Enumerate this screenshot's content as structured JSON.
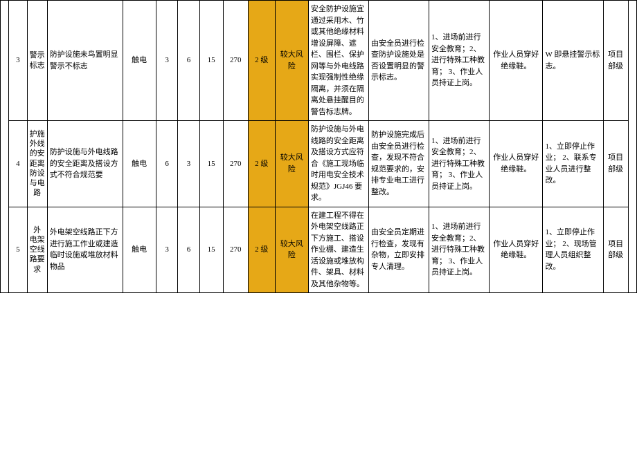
{
  "rows": [
    {
      "idx": "3",
      "cat": "警示标志",
      "desc": "防护设施未鸟置明显警示不标志",
      "hazard": "触电",
      "n1": "3",
      "n2": "6",
      "n3": "15",
      "n4": "270",
      "level": "2 级",
      "risk": "较大风险",
      "measure1": "安全防护设施宜通过采用木、竹或其他绝缘材料增设屏障、遮栏、围栏、保护网等与外电线路实现强制性绝缘隔离，并须在隔离处悬挂醒目的警告标志牌。",
      "measure2": "由安全员进行检查防护设施处是否设置明显的警示标志。",
      "measure3": "1、进场前进行安全教育；2、进行特殊工种教育；\n3、作业人员持证上岗。",
      "measure4": "作业人员穿好绝缘鞋。",
      "measure5": "W 即悬挂警示标志。",
      "owner": "项目部级"
    },
    {
      "idx": "4",
      "cat": "护施外线的安距离防设与电路",
      "desc": "防护设施与外电线路的安全距离及搭设方式不符合规范要",
      "hazard": "触电",
      "n1": "6",
      "n2": "3",
      "n3": "15",
      "n4": "270",
      "level": "2 级",
      "risk": "较大风险",
      "measure1": "防护设施与外电线路的安全距离及搭设方式应符合《施工现场临时用电安全技术规范》JGJ46 要求。",
      "measure2": "防护设施完成后由安全员进行检查，发现不符合规范要求的，安排专业电工进行整改。",
      "measure3": "1、进场前进行安全教育；2、进行特殊工种教育；\n3、作业人员持证上岗。",
      "measure4": "作业人员穿好绝缘鞋。",
      "measure5": "1、立即停止作业；\n2、联系专业人员进行整改。",
      "owner": "项目部级"
    },
    {
      "idx": "5",
      "cat": "外 电架 空线 路要 求",
      "desc": "外电架空线路正下方进行施工作业或建造临时设施或堆放材料物品",
      "hazard": "触电",
      "n1": "3",
      "n2": "6",
      "n3": "15",
      "n4": "270",
      "level": "2 级",
      "risk": "较大风险",
      "measure1": "在建工程不得在外电架空线路正下方施工、搭设作业棚、建造生活设施或堆放构件、架具、材料及其他杂物等。",
      "measure2": "由安全员定期进行检查，发现有杂物，立即安排专人清理。",
      "measure3": "1、进场前进行安全教育；2、进行特殊工种教育；\n3、作业人员持证上岗。",
      "measure4": "作业人员穿好绝缘鞋。",
      "measure5": "1、立即停止作业；\n2、现场管理人员组织整改。",
      "owner": "项目部级"
    }
  ]
}
